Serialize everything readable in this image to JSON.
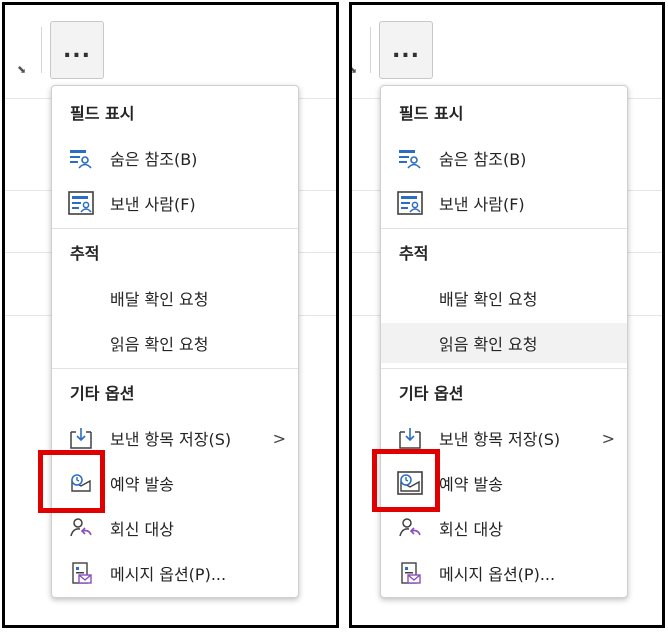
{
  "more_button_label": "...",
  "menu": {
    "section_show_fields": "필드 표시",
    "bcc": "숨은 참조(B)",
    "from": "보낸 사람(F)",
    "section_tracking": "추적",
    "delivery_receipt": "배달 확인 요청",
    "read_receipt": "읽음 확인 요청",
    "section_more_options": "기타 옵션",
    "save_sent_items": "보낸 항목 저장(S)",
    "save_sent_items_chevron": ">",
    "delay_delivery": "예약 발송",
    "direct_replies": "회신 대상",
    "message_options": "메시지 옵션(P)..."
  },
  "colors": {
    "highlight_box": "#e00000",
    "accent_blue": "#2b6cc4",
    "accent_purple": "#8a4fbf",
    "hover_bg": "#f2f2f2"
  }
}
